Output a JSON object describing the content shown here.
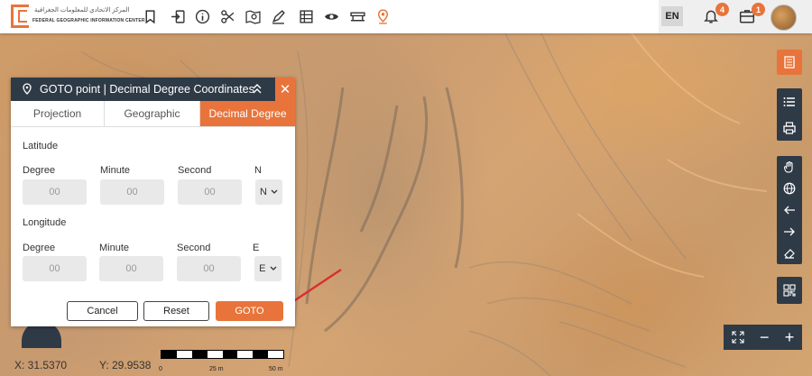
{
  "header": {
    "logo_ar": "المركز الاتحادي للمعلومات الجغرافية",
    "logo_en": "FEDERAL GEOGRAPHIC INFORMATION CENTER",
    "tools": [
      "bookmark-icon",
      "login-icon",
      "info-icon",
      "scissors-icon",
      "map-search-icon",
      "draw-icon",
      "table-icon",
      "eye-icon",
      "layers-icon",
      "location-pin-icon"
    ],
    "lang": "EN",
    "notifications_count": "4",
    "messages_count": "1"
  },
  "dialog": {
    "title": "GOTO point | Decimal Degree Coordinates",
    "tabs": [
      "Projection",
      "Geographic",
      "Decimal Degree"
    ],
    "active_tab": "Decimal Degree",
    "latitude": {
      "section": "Latitude",
      "labels": [
        "Degree",
        "Minute",
        "Second",
        "N"
      ],
      "degree": "00",
      "minute": "00",
      "second": "00",
      "hemisphere": "N"
    },
    "longitude": {
      "section": "Longitude",
      "labels": [
        "Degree",
        "Minute",
        "Second",
        "E"
      ],
      "degree": "00",
      "minute": "00",
      "second": "00",
      "hemisphere": "E"
    },
    "buttons": {
      "cancel": "Cancel",
      "reset": "Reset",
      "goto": "GOTO"
    }
  },
  "status": {
    "x": "X: 31.5370",
    "y": "Y: 29.9538",
    "scale_labels": [
      "0",
      "25 m",
      "50 m"
    ]
  },
  "colors": {
    "accent": "#e8743b",
    "dark": "#2f3a47"
  }
}
